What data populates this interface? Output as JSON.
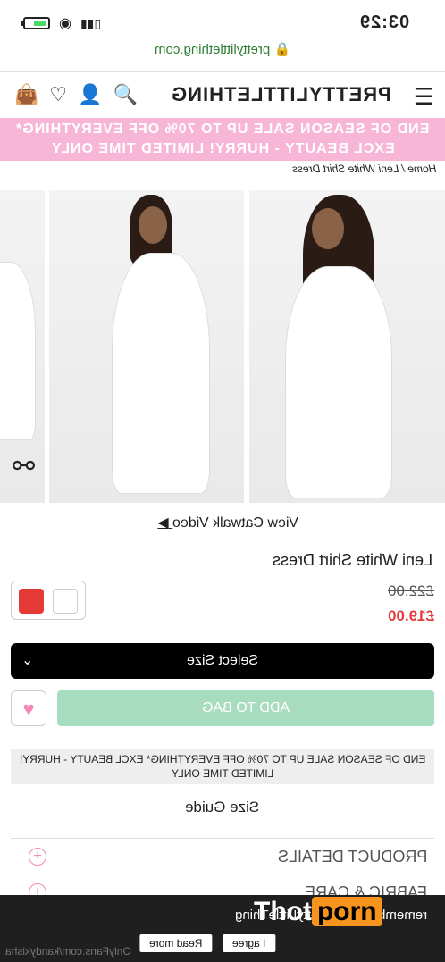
{
  "status_bar": {
    "time": "03:29",
    "icons": [
      "battery-icon",
      "wifi-icon",
      "signal-icon"
    ]
  },
  "browser": {
    "url": "prettylittlething.com"
  },
  "header": {
    "logo": "PRETTYLITTLETHING",
    "icons": [
      "bag-icon",
      "heart-icon",
      "user-icon",
      "search-icon",
      "menu-icon"
    ]
  },
  "promo_banner": {
    "line1": "END OF SEASON SALE UP TO 70% OFF EVERYTHING*",
    "line2": "EXCL BEAUTY - HURRY! LIMITED TIME ONLY"
  },
  "breadcrumb": "Home / Leni White Shirt Dress",
  "product": {
    "video_link": "View Catwalk Video",
    "title": "Leni White Shirt Dress",
    "old_price": "£22.00",
    "new_price": "£19.00",
    "swatches": [
      "#e53935",
      "#ffffff"
    ]
  },
  "actions": {
    "select_size": "Select Size",
    "add_to_bag": "ADD TO BAG"
  },
  "promo_box": {
    "line1": "END OF SEASON SALE UP TO 70% OFF EVERYTHING* EXCL BEAUTY - HURRY!",
    "line2": "LIMITED TIME ONLY"
  },
  "size_guide": "Size Guide",
  "accordion": [
    {
      "label": "PRODUCT DETAILS"
    },
    {
      "label": "FABRIC & CARE"
    }
  ],
  "cookie": {
    "message": "remember from PrettyLittleThing",
    "read_more": "Read more",
    "agree": "I agree"
  },
  "watermark": {
    "logo_a": "Thot",
    "logo_b": "porn",
    "text": "OnlyFans.com/kandykisha"
  }
}
